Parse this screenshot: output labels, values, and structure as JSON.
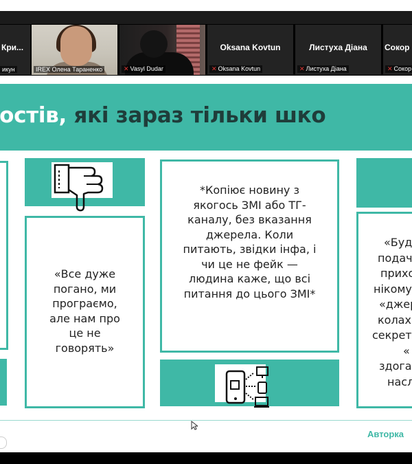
{
  "participants": [
    {
      "name": "Кри...",
      "caption": "икун",
      "muted": false
    },
    {
      "name": "",
      "caption": "IREX Олена Тараненко",
      "muted": false
    },
    {
      "name": "",
      "caption": "Vasyl Dudar",
      "muted": true
    },
    {
      "name": "Oksana Kovtun",
      "caption": "Oksana Kovtun",
      "muted": true
    },
    {
      "name": "Листуха Діана",
      "caption": "Листуха Діана",
      "muted": true
    },
    {
      "name": "Сокор",
      "caption": "Сокор",
      "muted": true
    }
  ],
  "slide": {
    "title_part1": "постів,",
    "title_part2": "які зараз тільки шко",
    "card_left": [
      "«Все дуже",
      "погано, ми",
      "програємо,",
      "але нам про",
      "це не",
      "говорять»"
    ],
    "card_center": [
      "*Копіює новину з",
      "якогось ЗМІ або ТГ-",
      "каналу, без вказання",
      "джерела. Коли",
      "питають, звідки інфа, і",
      "чи це не фейк —",
      "людина каже, що всі",
      "питання до цього ЗМІ*"
    ],
    "card_right": [
      "«Буд",
      "подач",
      "прихо",
      "нікому",
      "«джер",
      "колах",
      "секрету",
      "«",
      "здога",
      "насл"
    ],
    "footer": "Авторка"
  },
  "colors": {
    "accent": "#3fb8a6",
    "title_dark": "#1f3d3a",
    "muted_mic": "#e53935"
  },
  "icons": {
    "left": "thumbs-down-icon",
    "center": "phone-network-icon"
  }
}
